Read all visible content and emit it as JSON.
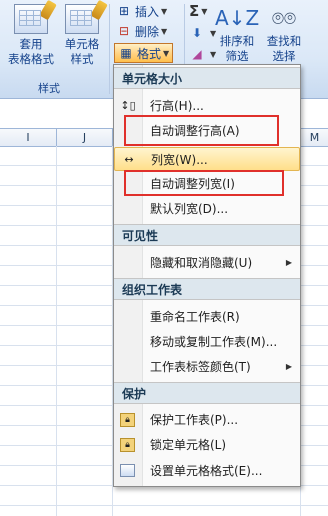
{
  "ribbon": {
    "format_table_label": "套用\n表格格式",
    "cell_style_label": "单元格\n样式",
    "styles_group_label": "样式",
    "insert_label": "插入",
    "delete_label": "删除",
    "format_label": "格式",
    "sigma_glyph": "Σ",
    "sort_filter_label": "排序和\n筛选",
    "find_select_label": "查找和\n选择"
  },
  "sheet": {
    "columns": [
      "I",
      "J",
      "M"
    ]
  },
  "menu": {
    "sections": {
      "cell_size": "单元格大小",
      "visibility": "可见性",
      "organize_sheets": "组织工作表",
      "protection": "保护"
    },
    "items": {
      "row_height": "行高(H)...",
      "autofit_row_height": "自动调整行高(A)",
      "column_width": "列宽(W)...",
      "autofit_column_width": "自动调整列宽(I)",
      "default_width": "默认列宽(D)...",
      "hide_unhide": "隐藏和取消隐藏(U)",
      "rename_sheet": "重命名工作表(R)",
      "move_copy_sheet": "移动或复制工作表(M)...",
      "tab_color": "工作表标签颜色(T)",
      "protect_sheet": "保护工作表(P)...",
      "lock_cell": "锁定单元格(L)",
      "format_cells": "设置单元格格式(E)..."
    },
    "hovered_item": "column_width",
    "highlight_color": "#e0302b"
  }
}
